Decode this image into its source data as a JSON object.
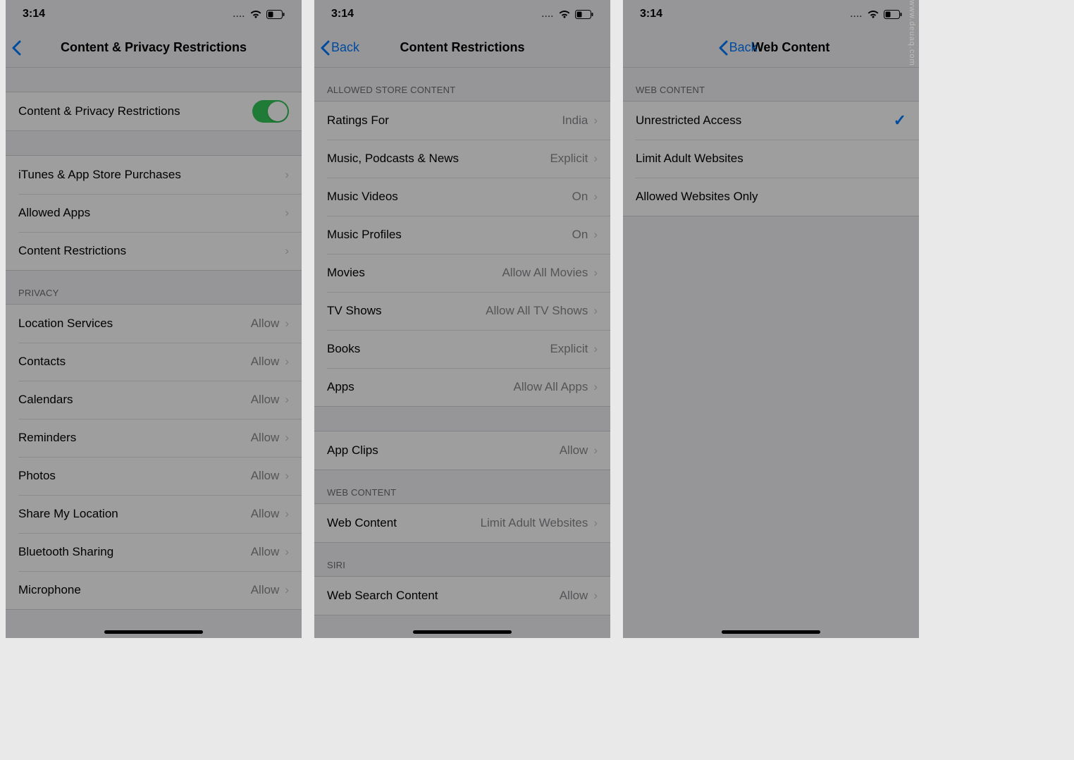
{
  "time": "3:14",
  "screens": {
    "a": {
      "title": "Content & Privacy Restrictions",
      "toggle_label": "Content & Privacy Restrictions",
      "rows": {
        "itunes": "iTunes & App Store Purchases",
        "allowed_apps": "Allowed Apps",
        "content_restrictions": "Content Restrictions"
      },
      "privacy_header": "Privacy",
      "privacy_rows": [
        {
          "label": "Location Services",
          "value": "Allow"
        },
        {
          "label": "Contacts",
          "value": "Allow"
        },
        {
          "label": "Calendars",
          "value": "Allow"
        },
        {
          "label": "Reminders",
          "value": "Allow"
        },
        {
          "label": "Photos",
          "value": "Allow"
        },
        {
          "label": "Share My Location",
          "value": "Allow"
        },
        {
          "label": "Bluetooth Sharing",
          "value": "Allow"
        },
        {
          "label": "Microphone",
          "value": "Allow"
        }
      ]
    },
    "b": {
      "back": "Back",
      "title": "Content Restrictions",
      "store_header": "Allowed Store Content",
      "store_rows": [
        {
          "label": "Ratings For",
          "value": "India"
        },
        {
          "label": "Music, Podcasts & News",
          "value": "Explicit"
        },
        {
          "label": "Music Videos",
          "value": "On"
        },
        {
          "label": "Music Profiles",
          "value": "On"
        },
        {
          "label": "Movies",
          "value": "Allow All Movies"
        },
        {
          "label": "TV Shows",
          "value": "Allow All TV Shows"
        },
        {
          "label": "Books",
          "value": "Explicit"
        },
        {
          "label": "Apps",
          "value": "Allow All Apps"
        }
      ],
      "appclips": {
        "label": "App Clips",
        "value": "Allow"
      },
      "web_header": "Web Content",
      "web_row": {
        "label": "Web Content",
        "value": "Limit Adult Websites"
      },
      "siri_header": "Siri",
      "siri_row": {
        "label": "Web Search Content",
        "value": "Allow"
      }
    },
    "c": {
      "back": "Back",
      "title": "Web Content",
      "header": "Web Content",
      "options": [
        {
          "label": "Unrestricted Access",
          "selected": true
        },
        {
          "label": "Limit Adult Websites",
          "selected": false
        },
        {
          "label": "Allowed Websites Only",
          "selected": false
        }
      ]
    }
  },
  "watermark": "www.deuaq.com"
}
